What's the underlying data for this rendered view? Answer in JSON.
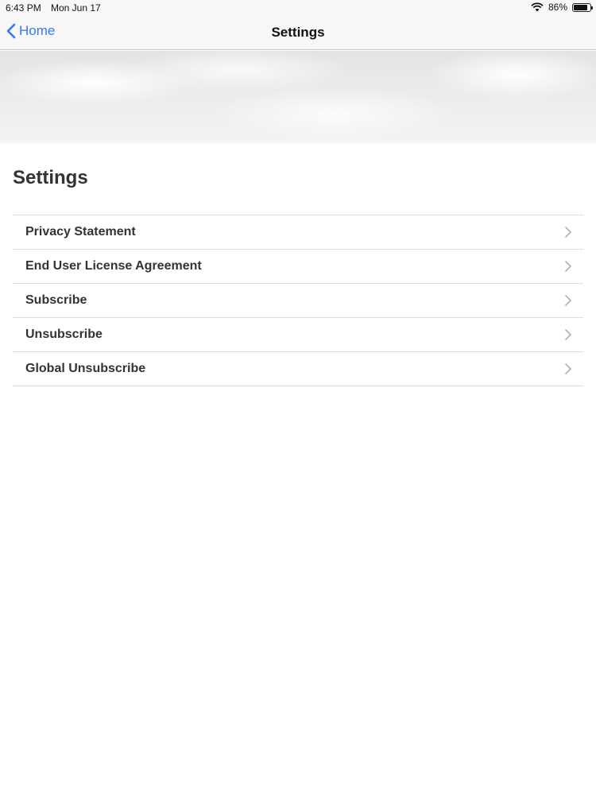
{
  "status_bar": {
    "time": "6:43 PM",
    "date": "Mon Jun 17",
    "battery_percent": "86%",
    "battery_level": 0.86
  },
  "nav": {
    "back_label": "Home",
    "title": "Settings"
  },
  "page": {
    "heading": "Settings"
  },
  "settings": {
    "items": [
      {
        "label": "Privacy Statement"
      },
      {
        "label": "End User License Agreement"
      },
      {
        "label": "Subscribe"
      },
      {
        "label": "Unsubscribe"
      },
      {
        "label": "Global Unsubscribe"
      }
    ]
  },
  "colors": {
    "accent": "#3478f6",
    "text": "#333333",
    "divider": "#dddddd"
  },
  "icons": {
    "back": "chevron-left-icon",
    "row": "chevron-right-icon",
    "wifi": "wifi-icon",
    "battery": "battery-icon"
  }
}
